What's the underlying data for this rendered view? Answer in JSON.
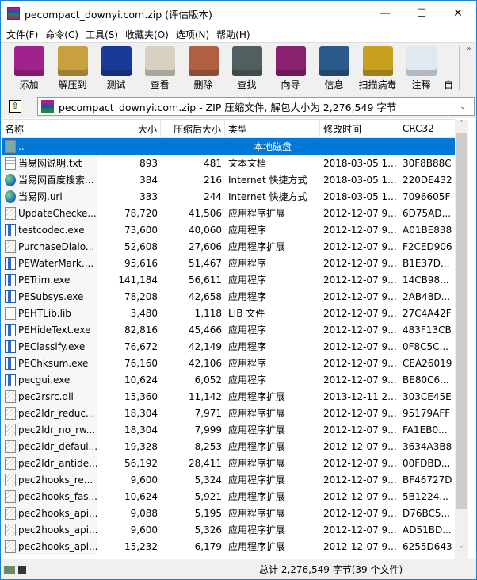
{
  "window": {
    "title": "pecompact_downyi.com.zip (评估版本)",
    "minimize": "—",
    "maximize": "☐",
    "close": "✕"
  },
  "menu": [
    "文件(F)",
    "命令(C)",
    "工具(S)",
    "收藏夹(O)",
    "选项(N)",
    "帮助(H)"
  ],
  "toolbar": [
    {
      "label": "添加",
      "color": "#a0228c"
    },
    {
      "label": "解压到",
      "color": "#c8a040"
    },
    {
      "label": "测试",
      "color": "#1a3a9a"
    },
    {
      "label": "查看",
      "color": "#d8d0c0"
    },
    {
      "label": "删除",
      "color": "#b06040"
    },
    {
      "label": "查找",
      "color": "#506060"
    },
    {
      "label": "向导",
      "color": "#8a2070"
    },
    {
      "label": "信息",
      "color": "#2a5a8a"
    },
    {
      "label": "扫描病毒",
      "color": "#c8a020"
    },
    {
      "label": "注释",
      "color": "#e0e8f0"
    },
    {
      "label": "自"
    }
  ],
  "toolbar_more": "»",
  "address": {
    "up": "⇧",
    "text": "pecompact_downyi.com.zip - ZIP 压缩文件, 解包大小为 2,276,549 字节",
    "dropdown": "⌄"
  },
  "columns": [
    "名称",
    "大小",
    "压缩后大小",
    "类型",
    "修改时间",
    "CRC32"
  ],
  "rows": [
    {
      "icon": "folder",
      "name": "..",
      "size": "",
      "packed": "",
      "type": "本地磁盘",
      "modified": "",
      "crc": ""
    },
    {
      "icon": "txt",
      "name": "当易网说明.txt",
      "size": "893",
      "packed": "481",
      "type": "文本文档",
      "modified": "2018-03-05 1...",
      "crc": "30F8B88C"
    },
    {
      "icon": "globe",
      "name": "当易网百度搜索...",
      "size": "384",
      "packed": "216",
      "type": "Internet 快捷方式",
      "modified": "2018-03-05 1...",
      "crc": "220DE432"
    },
    {
      "icon": "globe",
      "name": "当易网.url",
      "size": "333",
      "packed": "244",
      "type": "Internet 快捷方式",
      "modified": "2018-03-05 1...",
      "crc": "7096605F"
    },
    {
      "icon": "dll",
      "name": "UpdateChecke...",
      "size": "78,720",
      "packed": "41,506",
      "type": "应用程序扩展",
      "modified": "2012-12-07 9...",
      "crc": "6D75AD..."
    },
    {
      "icon": "exe",
      "name": "testcodec.exe",
      "size": "73,600",
      "packed": "40,060",
      "type": "应用程序",
      "modified": "2012-12-07 9...",
      "crc": "A01BE838"
    },
    {
      "icon": "dll",
      "name": "PurchaseDialo...",
      "size": "52,608",
      "packed": "27,606",
      "type": "应用程序扩展",
      "modified": "2012-12-07 9...",
      "crc": "F2CED906"
    },
    {
      "icon": "exe",
      "name": "PEWaterMark....",
      "size": "95,616",
      "packed": "51,467",
      "type": "应用程序",
      "modified": "2012-12-07 9...",
      "crc": "B1E37D..."
    },
    {
      "icon": "exe",
      "name": "PETrim.exe",
      "size": "141,184",
      "packed": "56,611",
      "type": "应用程序",
      "modified": "2012-12-07 9...",
      "crc": "14CB98..."
    },
    {
      "icon": "exe",
      "name": "PESubsys.exe",
      "size": "78,208",
      "packed": "42,658",
      "type": "应用程序",
      "modified": "2012-12-07 9...",
      "crc": "2AB48D..."
    },
    {
      "icon": "file",
      "name": "PEHTLib.lib",
      "size": "3,480",
      "packed": "1,118",
      "type": "LIB 文件",
      "modified": "2012-12-07 9...",
      "crc": "27C4A42F"
    },
    {
      "icon": "exe",
      "name": "PEHideText.exe",
      "size": "82,816",
      "packed": "45,466",
      "type": "应用程序",
      "modified": "2012-12-07 9...",
      "crc": "483F13CB"
    },
    {
      "icon": "exe",
      "name": "PEClassify.exe",
      "size": "76,672",
      "packed": "42,149",
      "type": "应用程序",
      "modified": "2012-12-07 9...",
      "crc": "0F8C5C..."
    },
    {
      "icon": "exe",
      "name": "PEChksum.exe",
      "size": "76,160",
      "packed": "42,106",
      "type": "应用程序",
      "modified": "2012-12-07 9...",
      "crc": "CEA26019"
    },
    {
      "icon": "exe",
      "name": "pecgui.exe",
      "size": "10,624",
      "packed": "6,052",
      "type": "应用程序",
      "modified": "2012-12-07 9...",
      "crc": "BE80C6..."
    },
    {
      "icon": "dll",
      "name": "pec2rsrc.dll",
      "size": "15,360",
      "packed": "11,142",
      "type": "应用程序扩展",
      "modified": "2013-12-11 2...",
      "crc": "303CE45E"
    },
    {
      "icon": "dll",
      "name": "pec2ldr_reduc...",
      "size": "18,304",
      "packed": "7,971",
      "type": "应用程序扩展",
      "modified": "2012-12-07 9...",
      "crc": "95179AFF"
    },
    {
      "icon": "dll",
      "name": "pec2ldr_no_rw...",
      "size": "18,304",
      "packed": "7,999",
      "type": "应用程序扩展",
      "modified": "2012-12-07 9...",
      "crc": "FA1EB0..."
    },
    {
      "icon": "dll",
      "name": "pec2ldr_defaul...",
      "size": "19,328",
      "packed": "8,253",
      "type": "应用程序扩展",
      "modified": "2012-12-07 9...",
      "crc": "3634A3B8"
    },
    {
      "icon": "dll",
      "name": "pec2ldr_antide...",
      "size": "56,192",
      "packed": "28,411",
      "type": "应用程序扩展",
      "modified": "2012-12-07 9...",
      "crc": "00FDBD..."
    },
    {
      "icon": "dll",
      "name": "pec2hooks_re...",
      "size": "9,600",
      "packed": "5,324",
      "type": "应用程序扩展",
      "modified": "2012-12-07 9...",
      "crc": "BF46727D"
    },
    {
      "icon": "dll",
      "name": "pec2hooks_fas...",
      "size": "10,624",
      "packed": "5,921",
      "type": "应用程序扩展",
      "modified": "2012-12-07 9...",
      "crc": "5B1224..."
    },
    {
      "icon": "dll",
      "name": "pec2hooks_api...",
      "size": "9,088",
      "packed": "5,195",
      "type": "应用程序扩展",
      "modified": "2012-12-07 9...",
      "crc": "D76BC5..."
    },
    {
      "icon": "dll",
      "name": "pec2hooks_api...",
      "size": "9,600",
      "packed": "5,326",
      "type": "应用程序扩展",
      "modified": "2012-12-07 9...",
      "crc": "AD51BD..."
    },
    {
      "icon": "dll",
      "name": "pec2hooks_api...",
      "size": "15,232",
      "packed": "6,179",
      "type": "应用程序扩展",
      "modified": "2012-12-07 9...",
      "crc": "6255D643"
    }
  ],
  "status": {
    "total": "总计 2,276,549 字节(39 个文件)"
  },
  "scrollbar": {
    "up": "˄",
    "down": "˅",
    "position": 0
  }
}
